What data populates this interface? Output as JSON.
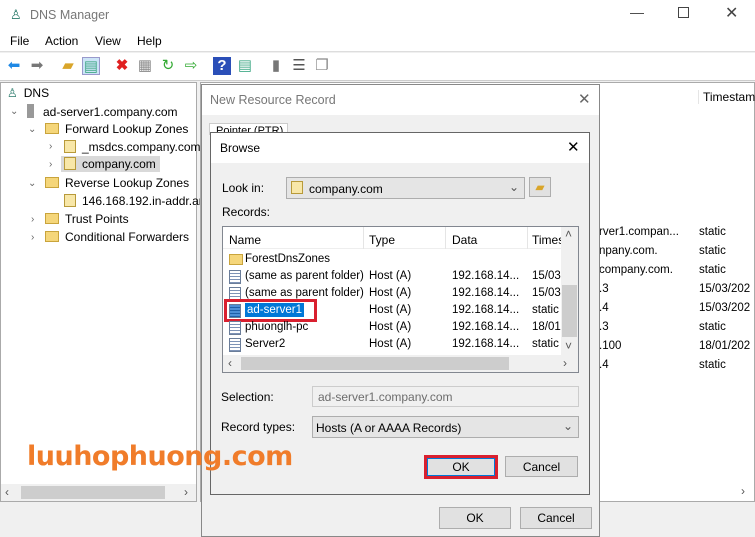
{
  "window": {
    "title": "DNS Manager",
    "controls": [
      "minimize",
      "maximize",
      "close"
    ]
  },
  "menu": [
    "File",
    "Action",
    "View",
    "Help"
  ],
  "toolbar": [
    "back-icon",
    "forward-icon",
    "up-folder-icon",
    "show-hide-tree-icon",
    "delete-icon",
    "properties-icon",
    "refresh-icon",
    "export-icon",
    "help-icon",
    "action-pane-icon",
    "server-icon",
    "list-icon",
    "copy-icon"
  ],
  "tree": {
    "root": "DNS",
    "server": "ad-server1.company.com",
    "forward": "Forward Lookup Zones",
    "msdcs": "_msdcs.company.com",
    "company": "company.com",
    "reverse": "Reverse Lookup Zones",
    "revzone": "146.168.192.in-addr.arpa",
    "trust": "Trust Points",
    "cond": "Conditional Forwarders"
  },
  "right": {
    "timestamp_header": "Timestam",
    "rows": [
      [
        "rver1.compan...",
        "static"
      ],
      [
        "npany.com.",
        "static"
      ],
      [
        "company.com.",
        "static"
      ],
      [
        ".3",
        "15/03/202"
      ],
      [
        ".4",
        "15/03/202"
      ],
      [
        ".3",
        "static"
      ],
      [
        ".100",
        "18/01/202"
      ],
      [
        ".4",
        "static"
      ]
    ]
  },
  "nrr": {
    "title": "New Resource Record",
    "tab": "Pointer (PTR)",
    "ok": "OK",
    "cancel": "Cancel"
  },
  "browse": {
    "title": "Browse",
    "look_in_label": "Look in:",
    "look_in_value": "company.com",
    "records_label": "Records:",
    "columns": [
      "Name",
      "Type",
      "Data",
      "Times"
    ],
    "rows": [
      {
        "name": "ForestDnsZones",
        "type": "",
        "data": "",
        "time": "",
        "folder": true
      },
      {
        "name": "(same as parent folder)",
        "type": "Host (A)",
        "data": "192.168.14...",
        "time": "15/03"
      },
      {
        "name": "(same as parent folder)",
        "type": "Host (A)",
        "data": "192.168.14...",
        "time": "15/03"
      },
      {
        "name": "ad-server1",
        "type": "Host (A)",
        "data": "192.168.14...",
        "time": "static",
        "selected": true
      },
      {
        "name": "phuonglh-pc",
        "type": "Host (A)",
        "data": "192.168.14...",
        "time": "18/01"
      },
      {
        "name": "Server2",
        "type": "Host (A)",
        "data": "192.168.14...",
        "time": "static"
      }
    ],
    "selection_label": "Selection:",
    "selection_value": "ad-server1.company.com",
    "record_types_label": "Record types:",
    "record_types_value": "Hosts (A or AAAA Records)",
    "ok": "OK",
    "cancel": "Cancel"
  },
  "watermark": "luuhophuong.com",
  "colors": {
    "highlight": "#0078d7",
    "annotation": "#d9202f",
    "watermark": "#f07c2a"
  }
}
